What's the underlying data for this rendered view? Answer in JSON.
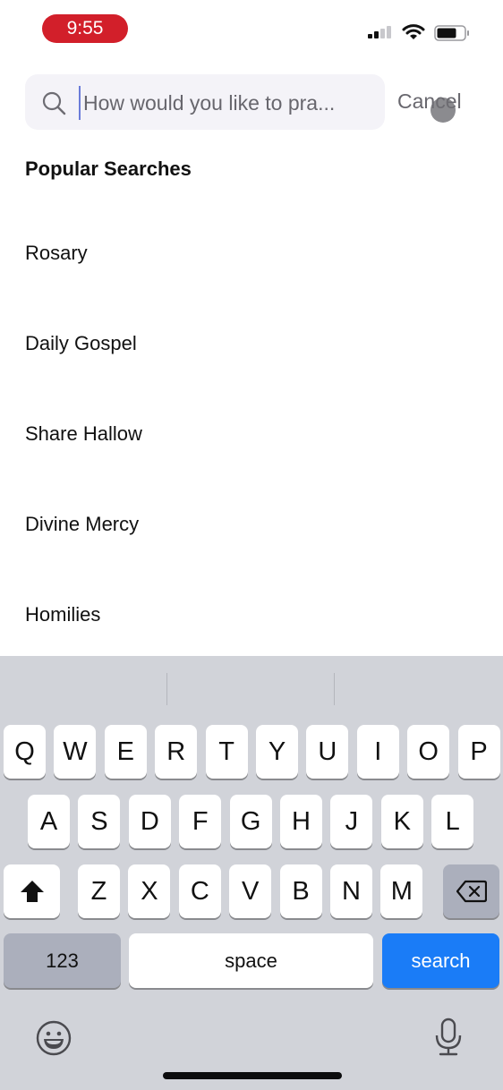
{
  "status_bar": {
    "time": "9:55",
    "time_pill_color": "#d21f2a",
    "signal_icon": "cellular-signal-icon",
    "wifi_icon": "wifi-icon",
    "battery_icon": "battery-icon"
  },
  "search": {
    "placeholder": "How would you like to pra...",
    "value": "",
    "cancel_label": "Cancel",
    "icon": "search-icon"
  },
  "popular": {
    "title": "Popular Searches",
    "items": [
      "Rosary",
      "Daily Gospel",
      "Share Hallow",
      "Divine Mercy",
      "Homilies"
    ]
  },
  "keyboard": {
    "row1": [
      "Q",
      "W",
      "E",
      "R",
      "T",
      "Y",
      "U",
      "I",
      "O",
      "P"
    ],
    "row2": [
      "A",
      "S",
      "D",
      "F",
      "G",
      "H",
      "J",
      "K",
      "L"
    ],
    "row3": [
      "Z",
      "X",
      "C",
      "V",
      "B",
      "N",
      "M"
    ],
    "numbers_label": "123",
    "space_label": "space",
    "search_label": "search",
    "search_color": "#1a7cf7",
    "shift_icon": "shift-icon",
    "delete_icon": "delete-icon",
    "emoji_icon": "emoji-icon",
    "mic_icon": "microphone-icon"
  }
}
